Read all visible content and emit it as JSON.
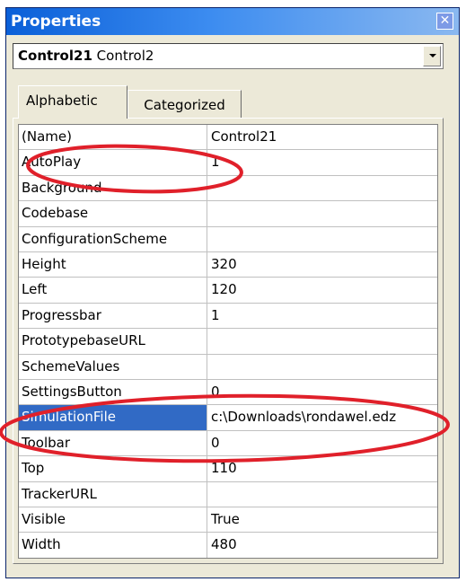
{
  "window": {
    "title": "Properties",
    "close_glyph": "✕",
    "object_combo": {
      "name": "Control21",
      "type": "Control2"
    }
  },
  "tabs": [
    {
      "label": "Alphabetic",
      "active": true
    },
    {
      "label": "Categorized",
      "active": false
    }
  ],
  "properties": [
    {
      "name": "(Name)",
      "value": "Control21"
    },
    {
      "name": "AutoPlay",
      "value": "1"
    },
    {
      "name": "Background",
      "value": ""
    },
    {
      "name": "Codebase",
      "value": ""
    },
    {
      "name": "ConfigurationScheme",
      "value": ""
    },
    {
      "name": "Height",
      "value": "320"
    },
    {
      "name": "Left",
      "value": "120"
    },
    {
      "name": "Progressbar",
      "value": "1"
    },
    {
      "name": "PrototypebaseURL",
      "value": ""
    },
    {
      "name": "SchemeValues",
      "value": ""
    },
    {
      "name": "SettingsButton",
      "value": "0"
    },
    {
      "name": "SimulationFile",
      "value": "c:\\Downloads\\rondawel.edz",
      "selected": true
    },
    {
      "name": "Toolbar",
      "value": "0"
    },
    {
      "name": "Top",
      "value": "110"
    },
    {
      "name": "TrackerURL",
      "value": ""
    },
    {
      "name": "Visible",
      "value": "True"
    },
    {
      "name": "Width",
      "value": "480"
    }
  ],
  "colors": {
    "titlebar": "#0a5fd8",
    "selection": "#316ac5",
    "annotation": "#e0202a",
    "window_bg": "#ece9d8"
  },
  "icons": {
    "close": "close-icon",
    "dropdown": "chevron-down-icon"
  }
}
